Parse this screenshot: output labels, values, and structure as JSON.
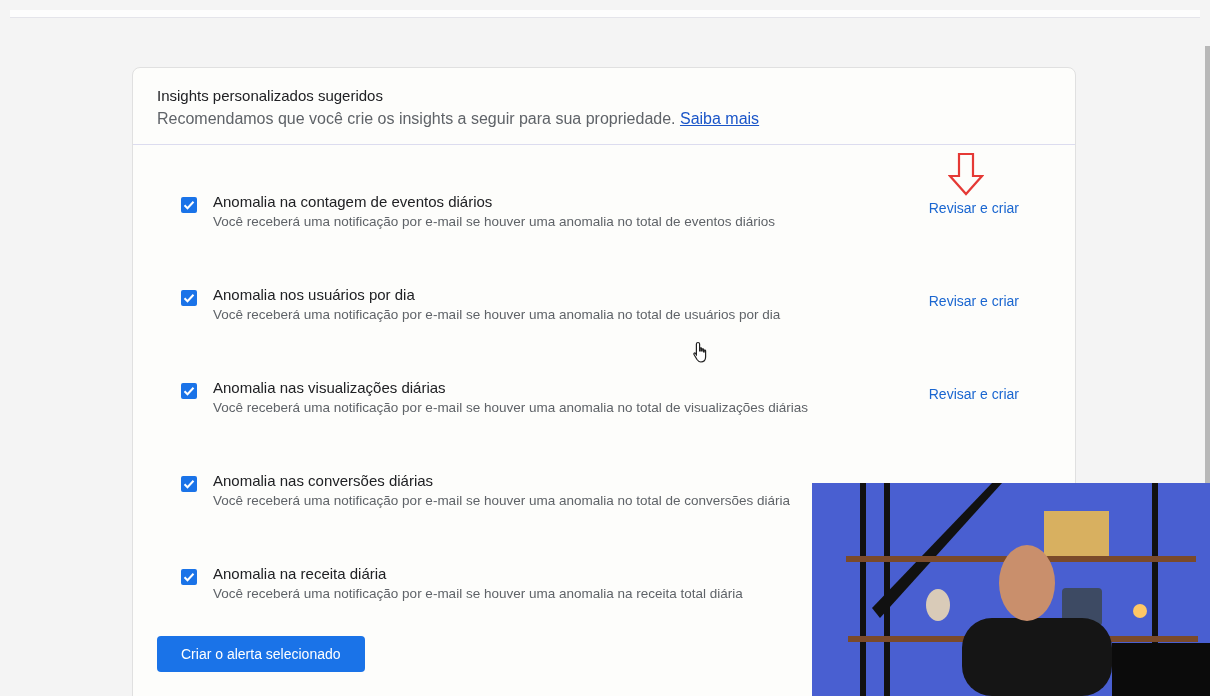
{
  "card": {
    "title": "Insights personalizados sugeridos",
    "description": "Recomendamos que você crie os insights a seguir para sua propriedade.",
    "link": "Saiba mais"
  },
  "rows": [
    {
      "title": "Anomalia na contagem de eventos diários",
      "description": "Você receberá uma notificação por e-mail se houver uma anomalia no total de eventos diários",
      "checked": true,
      "action": "Revisar e criar"
    },
    {
      "title": "Anomalia nos usuários por dia",
      "description": "Você receberá uma notificação por e-mail se houver uma anomalia no total de usuários por dia",
      "checked": true,
      "action": "Revisar e criar"
    },
    {
      "title": "Anomalia nas visualizações diárias",
      "description": "Você receberá uma notificação por e-mail se houver uma anomalia no total de visualizações diárias",
      "checked": true,
      "action": "Revisar e criar"
    },
    {
      "title": "Anomalia nas conversões diárias",
      "description": "Você receberá uma notificação por e-mail se houver uma anomalia no total de conversões diária",
      "checked": true
    },
    {
      "title": "Anomalia na receita diária",
      "description": "Você receberá uma notificação por e-mail se houver uma anomalia na receita total diária",
      "checked": true
    }
  ],
  "button": "Criar o alerta selecionado"
}
